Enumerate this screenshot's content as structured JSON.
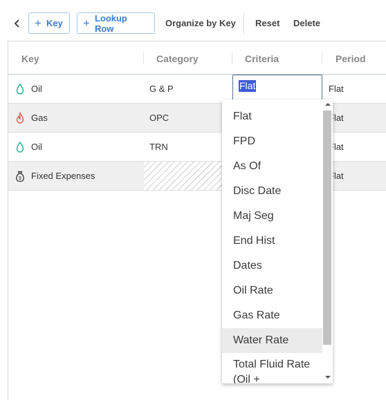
{
  "toolbar": {
    "add_key_label": "Key",
    "add_lookup_row_label": "Lookup Row",
    "organize_label": "Organize by Key",
    "reset_label": "Reset",
    "delete_label": "Delete"
  },
  "grid": {
    "columns": [
      "Key",
      "Category",
      "Criteria",
      "Period"
    ],
    "rows": [
      {
        "icon": "oil-drop-icon",
        "key": "Oil",
        "category": "G & P",
        "criteria": "Flat",
        "period": "Flat"
      },
      {
        "icon": "gas-flame-icon",
        "key": "Gas",
        "category": "OPC",
        "criteria": "",
        "period": "Flat"
      },
      {
        "icon": "oil-drop-icon",
        "key": "Oil",
        "category": "TRN",
        "criteria": "",
        "period": "Flat"
      },
      {
        "icon": "money-bag-icon",
        "key": "Fixed Expenses",
        "category": "",
        "criteria": "",
        "period": "Flat"
      }
    ]
  },
  "criteria_editor": {
    "value": "Flat"
  },
  "dropdown": {
    "options": [
      "Flat",
      "FPD",
      "As Of",
      "Disc Date",
      "Maj Seg",
      "End Hist",
      "Dates",
      "Oil Rate",
      "Gas Rate",
      "Water Rate",
      "Total Fluid Rate (Oil +"
    ],
    "highlighted": "Water Rate"
  },
  "colors": {
    "accent": "#3d7cc9",
    "oil_icon": "#2bb39a",
    "gas_icon": "#e05a4f",
    "selection": "#3c5bd8",
    "highlight": "#ebebeb"
  }
}
